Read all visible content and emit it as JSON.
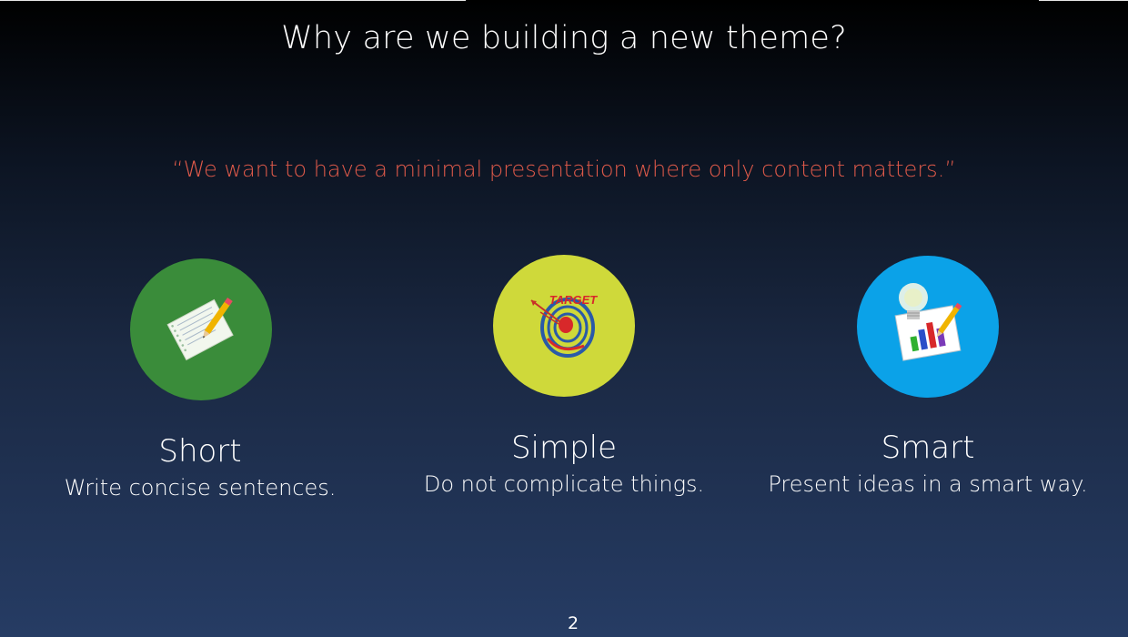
{
  "slide": {
    "title": "Why are we building a new theme?",
    "quote": "“We want to have a minimal presentation where only content matters.”",
    "page_number": "2"
  },
  "features": [
    {
      "title": "Short",
      "description": "Write concise sentences.",
      "icon": "notepad-pencil-icon",
      "color": "#3a8c3a"
    },
    {
      "title": "Simple",
      "description": "Do not complicate things.",
      "icon": "target-icon",
      "color": "#cfd93a",
      "icon_label": "TARGET"
    },
    {
      "title": "Smart",
      "description": "Present ideas in a smart way.",
      "icon": "lightbulb-chart-icon",
      "color": "#0ba2e8"
    }
  ],
  "colors": {
    "quote": "#e05a4a",
    "text": "#ffffff"
  }
}
